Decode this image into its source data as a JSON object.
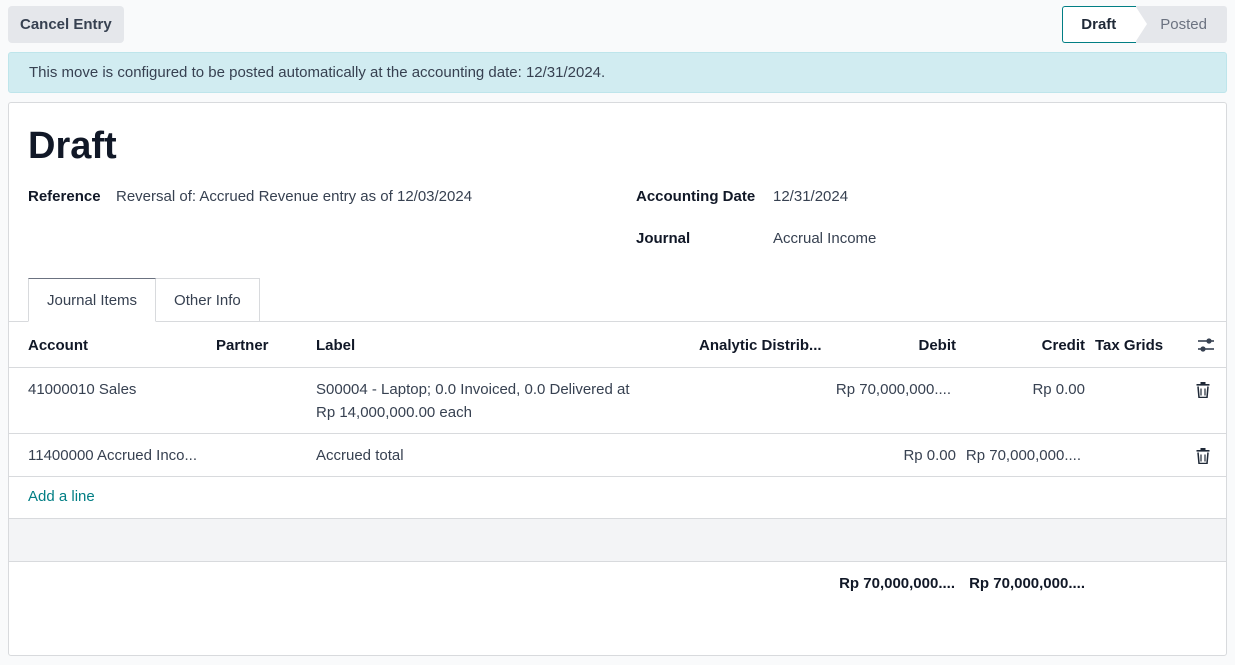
{
  "toolbar": {
    "cancel_label": "Cancel Entry",
    "status_steps": [
      "Draft",
      "Posted"
    ]
  },
  "alert": {
    "text": "This move is configured to be posted automatically at the accounting date: 12/31/2024."
  },
  "form": {
    "title": "Draft",
    "reference_label": "Reference",
    "reference_value": "Reversal of: Accrued Revenue entry as of 12/03/2024",
    "accounting_date_label": "Accounting Date",
    "accounting_date_value": "12/31/2024",
    "journal_label": "Journal",
    "journal_value": "Accrual Income"
  },
  "tabs": [
    "Journal Items",
    "Other Info"
  ],
  "table": {
    "columns": [
      "Account",
      "Partner",
      "Label",
      "Analytic Distrib...",
      "Debit",
      "Credit",
      "Tax Grids"
    ],
    "rows": [
      {
        "account": "41000010 Sales",
        "partner": "",
        "label_line1": "S00004 - Laptop; 0.0 Invoiced, 0.0 Delivered at",
        "label_line2": "Rp 14,000,000.00 each",
        "debit": "Rp 70,000,000....",
        "credit": "Rp 0.00"
      },
      {
        "account": "11400000 Accrued Inco...",
        "partner": "",
        "label_line1": "Accrued total",
        "label_line2": "",
        "debit": "Rp 0.00",
        "credit": "Rp 70,000,000...."
      }
    ],
    "add_line_label": "Add a line",
    "total_debit": "Rp 70,000,000....",
    "total_credit": "Rp 70,000,000...."
  },
  "colors": {
    "accent": "#017e84",
    "alert_bg": "#d1ecf1"
  },
  "icons": {
    "settings": "sliders-icon",
    "delete": "trash-icon"
  }
}
